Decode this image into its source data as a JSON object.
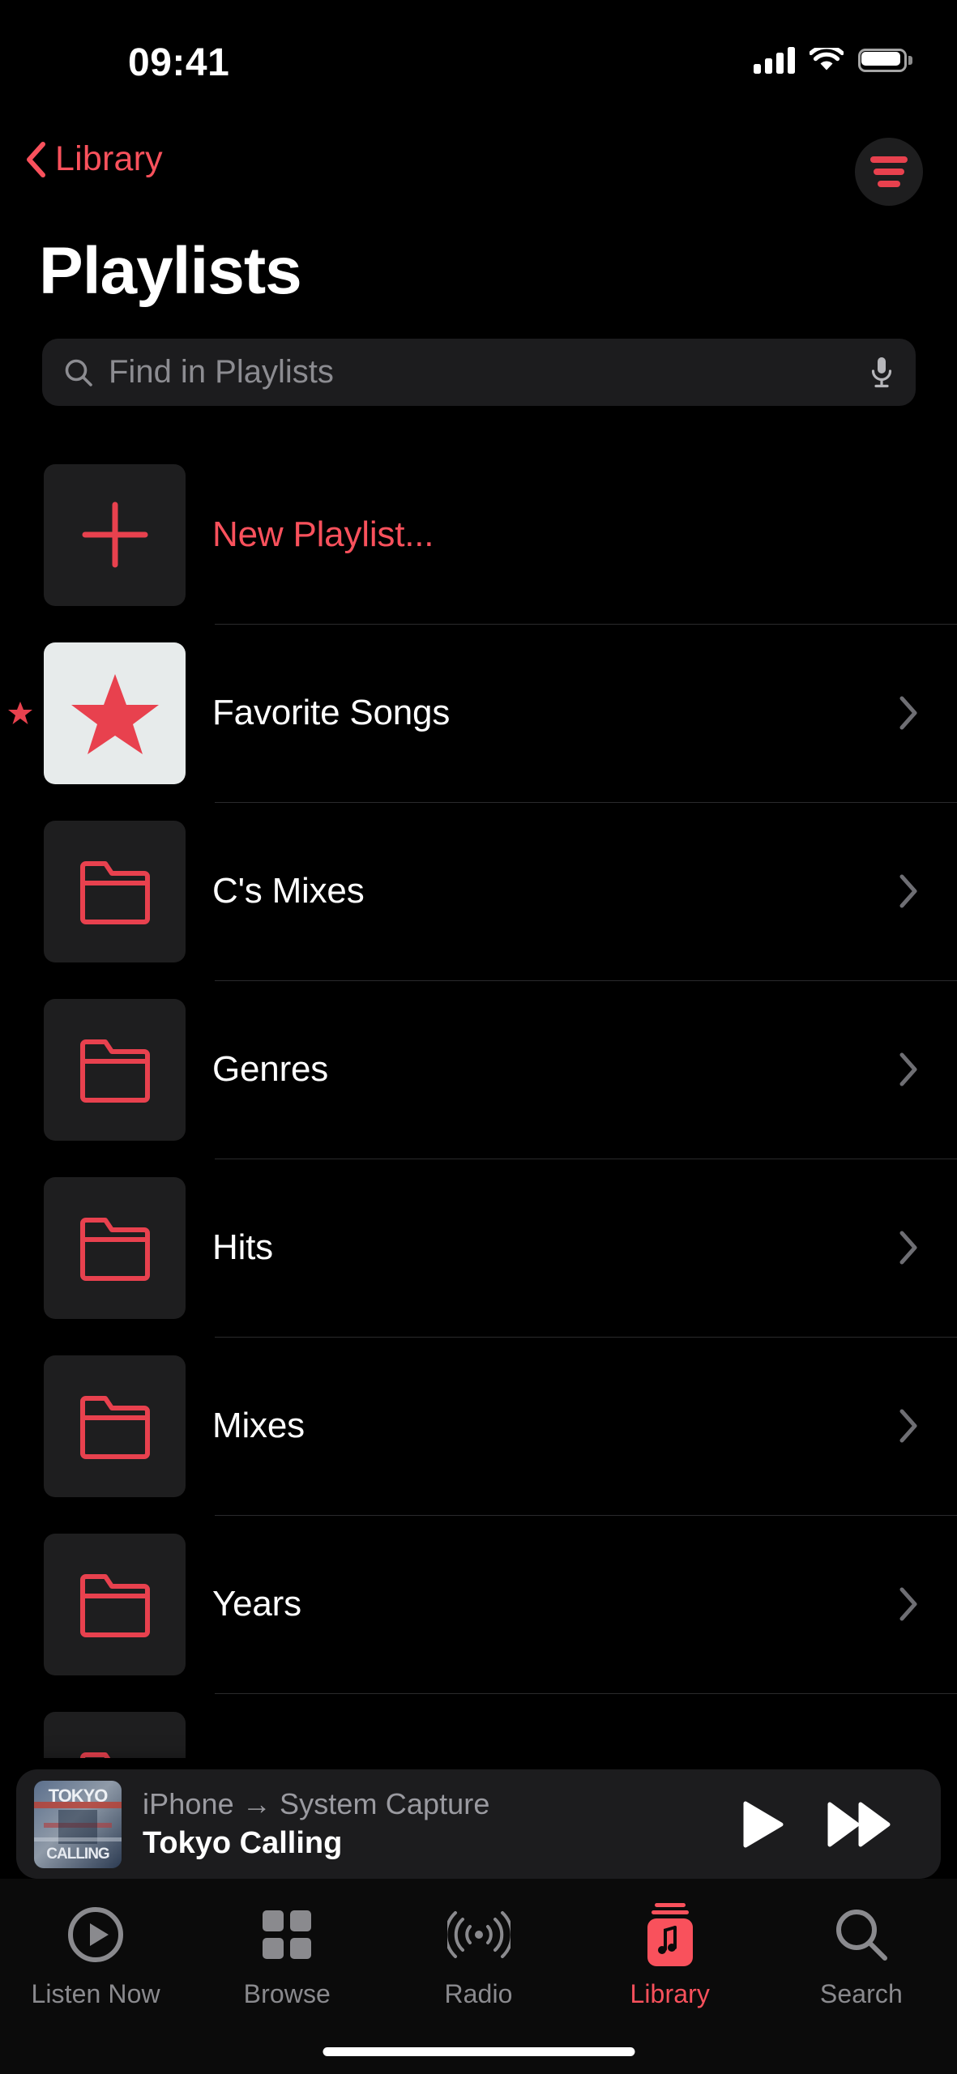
{
  "status_bar": {
    "time": "09:41",
    "signal_icon": "cellular-signal-icon",
    "wifi_icon": "wifi-icon",
    "battery_icon": "battery-full-icon"
  },
  "nav_bar": {
    "back_label": "Library",
    "back_icon": "chevron-left-icon",
    "filter_icon": "sort-filter-icon"
  },
  "page_title": "Playlists",
  "search": {
    "placeholder": "Find in Playlists",
    "value": "",
    "search_icon": "search-icon",
    "mic_icon": "microphone-icon"
  },
  "list": {
    "rows": [
      {
        "label": "New Playlist...",
        "icon": "plus-icon",
        "thumb_style": "dark",
        "accent": true,
        "chevron": false,
        "favorite_marker": false
      },
      {
        "label": "Favorite Songs",
        "icon": "star-icon",
        "thumb_style": "light",
        "accent": false,
        "chevron": true,
        "favorite_marker": true
      },
      {
        "label": "C's Mixes",
        "icon": "folder-icon",
        "thumb_style": "dark",
        "accent": false,
        "chevron": true,
        "favorite_marker": false
      },
      {
        "label": "Genres",
        "icon": "folder-icon",
        "thumb_style": "dark",
        "accent": false,
        "chevron": true,
        "favorite_marker": false
      },
      {
        "label": "Hits",
        "icon": "folder-icon",
        "thumb_style": "dark",
        "accent": false,
        "chevron": true,
        "favorite_marker": false
      },
      {
        "label": "Mixes",
        "icon": "folder-icon",
        "thumb_style": "dark",
        "accent": false,
        "chevron": true,
        "favorite_marker": false
      },
      {
        "label": "Years",
        "icon": "folder-icon",
        "thumb_style": "dark",
        "accent": false,
        "chevron": true,
        "favorite_marker": false
      },
      {
        "label": "",
        "icon": "folder-icon",
        "thumb_style": "dark",
        "accent": false,
        "chevron": false,
        "favorite_marker": false
      }
    ]
  },
  "now_playing": {
    "route": "iPhone → System Capture",
    "title": "Tokyo Calling",
    "artwork_text": "TOKYO CALLING",
    "play_icon": "play-icon",
    "forward_icon": "fast-forward-icon"
  },
  "tab_bar": {
    "tabs": [
      {
        "label": "Listen Now",
        "icon": "play-circle-icon",
        "active": false
      },
      {
        "label": "Browse",
        "icon": "grid-squares-icon",
        "active": false
      },
      {
        "label": "Radio",
        "icon": "radio-waves-icon",
        "active": false
      },
      {
        "label": "Library",
        "icon": "music-library-icon",
        "active": true
      },
      {
        "label": "Search",
        "icon": "magnifier-icon",
        "active": false
      }
    ]
  },
  "colors": {
    "accent": "#F9515C",
    "background": "#000000",
    "surface": "#1C1C1E",
    "separator": "#2A2A2C",
    "secondary_text": "#8A8A8E"
  }
}
